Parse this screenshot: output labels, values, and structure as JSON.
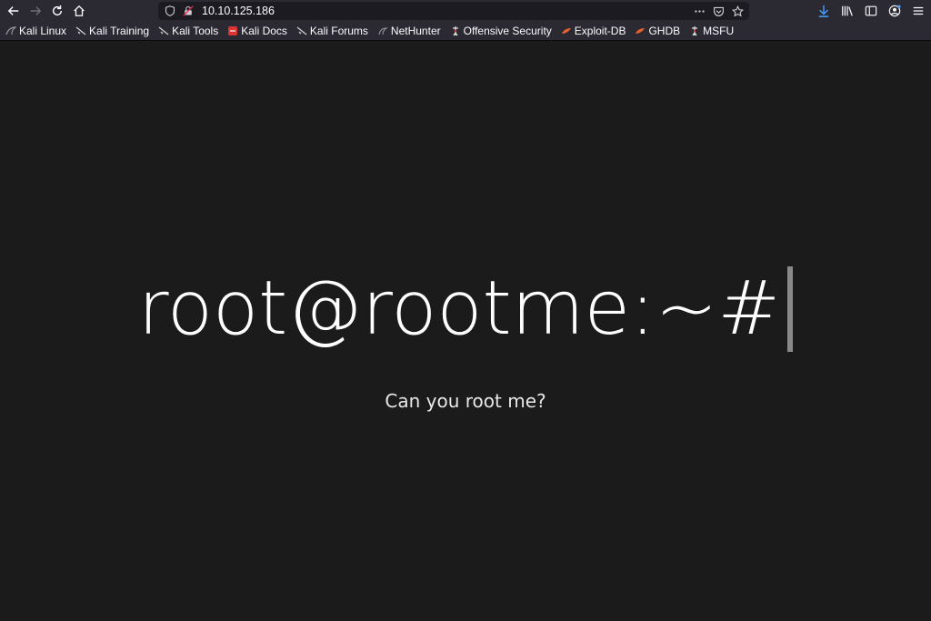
{
  "browser": {
    "url": "10.10.125.186",
    "bookmarks": [
      {
        "label": "Kali Linux",
        "icon": "kali-dragon-icon"
      },
      {
        "label": "Kali Training",
        "icon": "kali-dragon-icon"
      },
      {
        "label": "Kali Tools",
        "icon": "kali-dragon-icon"
      },
      {
        "label": "Kali Docs",
        "icon": "kali-docs-icon"
      },
      {
        "label": "Kali Forums",
        "icon": "kali-dragon-icon"
      },
      {
        "label": "NetHunter",
        "icon": "nethunter-icon"
      },
      {
        "label": "Offensive Security",
        "icon": "offsec-icon"
      },
      {
        "label": "Exploit-DB",
        "icon": "exploitdb-icon"
      },
      {
        "label": "GHDB",
        "icon": "ghdb-icon"
      },
      {
        "label": "MSFU",
        "icon": "msfu-icon"
      }
    ]
  },
  "page": {
    "headline": "root@rootme:~#",
    "tagline": "Can you root me?"
  },
  "colors": {
    "chrome_bg": "#2b2a33",
    "content_bg": "#1b1b1b",
    "accent_blue": "#45a1ff",
    "headline": "#ffffff",
    "cursor": "#8a8a8a"
  }
}
